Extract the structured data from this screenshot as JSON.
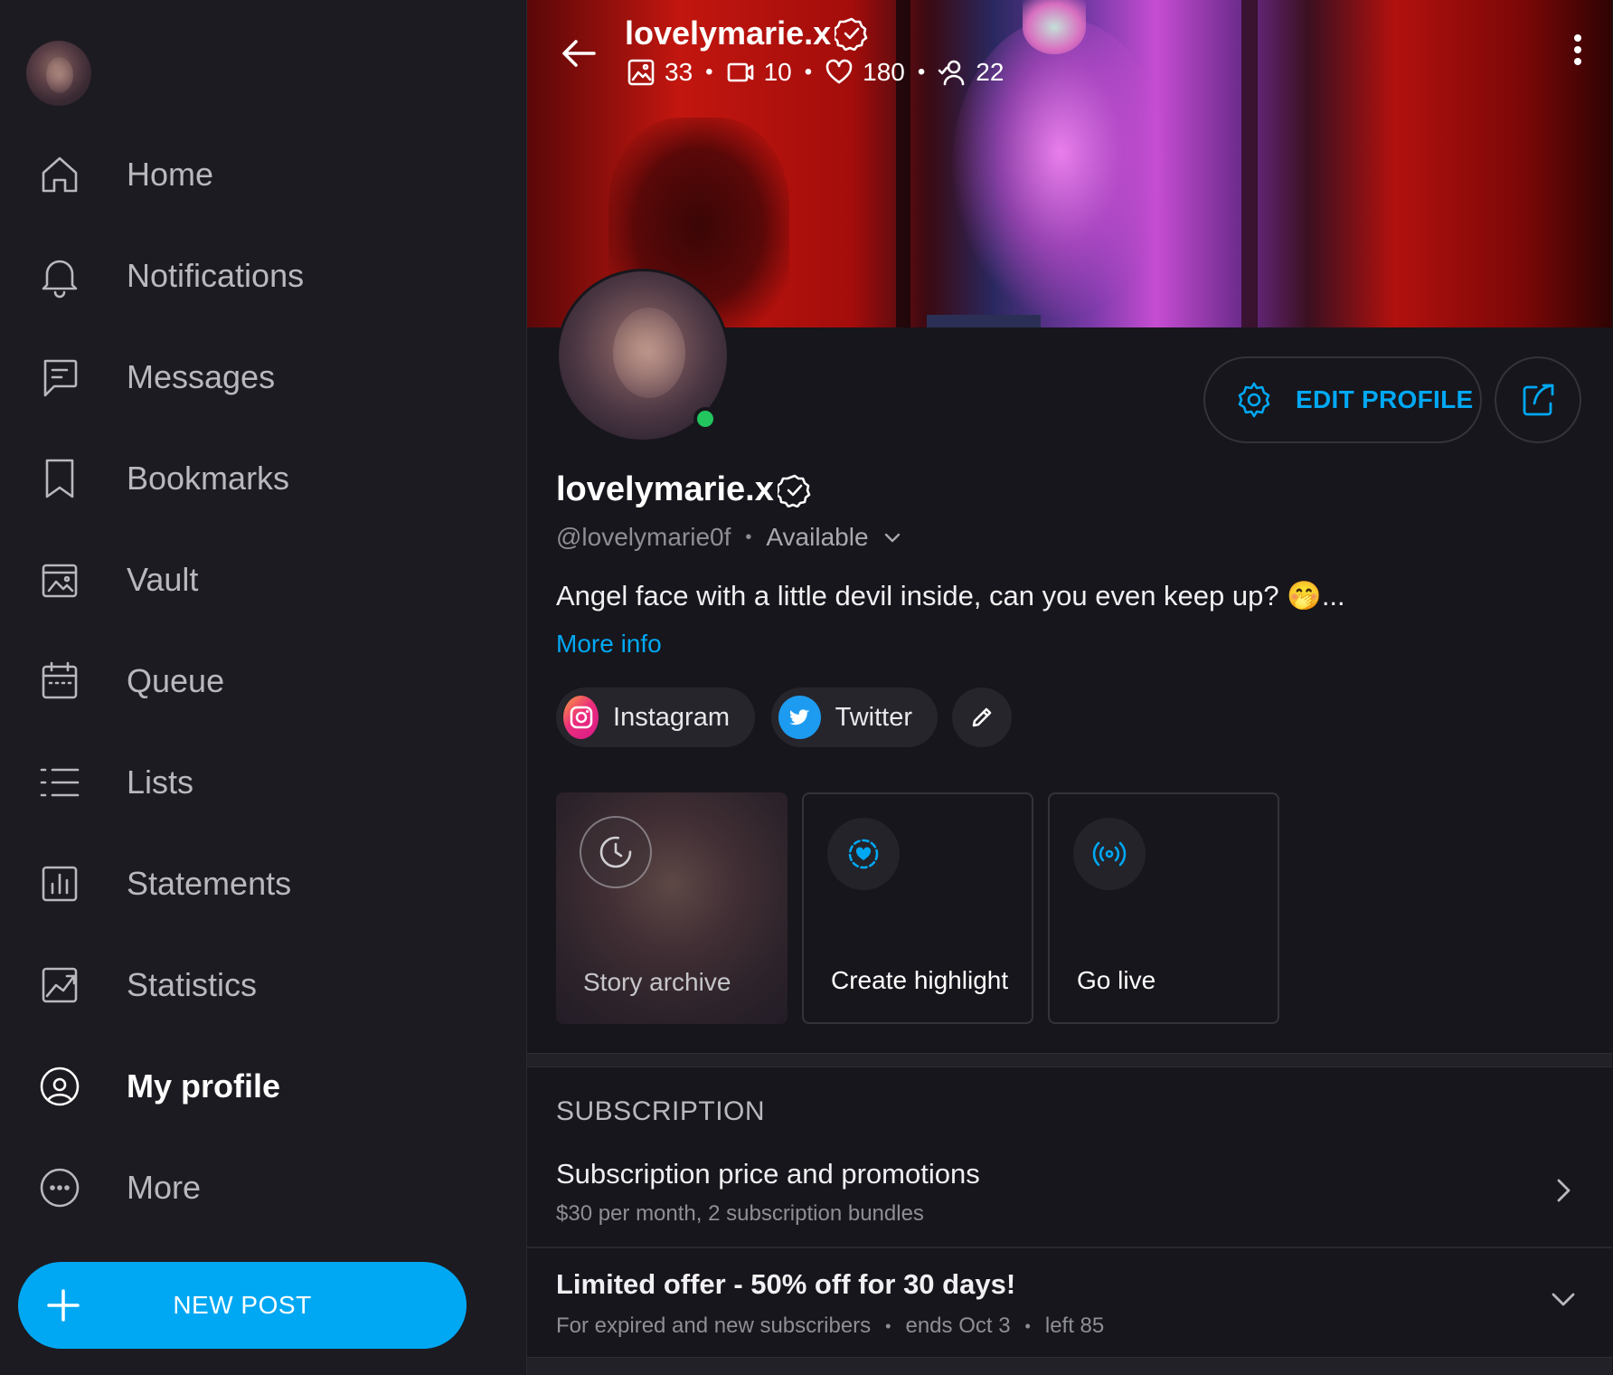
{
  "sidebar": {
    "nav": [
      {
        "label": "Home",
        "icon": "home-icon",
        "active": false
      },
      {
        "label": "Notifications",
        "icon": "bell-icon",
        "active": false
      },
      {
        "label": "Messages",
        "icon": "message-icon",
        "active": false
      },
      {
        "label": "Bookmarks",
        "icon": "bookmark-icon",
        "active": false
      },
      {
        "label": "Vault",
        "icon": "vault-icon",
        "active": false
      },
      {
        "label": "Queue",
        "icon": "calendar-icon",
        "active": false
      },
      {
        "label": "Lists",
        "icon": "list-icon",
        "active": false
      },
      {
        "label": "Statements",
        "icon": "statements-icon",
        "active": false
      },
      {
        "label": "Statistics",
        "icon": "statistics-icon",
        "active": false
      },
      {
        "label": "My profile",
        "icon": "profile-icon",
        "active": true
      },
      {
        "label": "More",
        "icon": "more-icon",
        "active": false
      }
    ],
    "new_post_label": "NEW POST"
  },
  "header": {
    "name": "lovelymarie.x",
    "stats": {
      "photos": "33",
      "videos": "10",
      "likes": "180",
      "fans": "22"
    }
  },
  "profile": {
    "name": "lovelymarie.x",
    "handle": "@lovelymarie0f",
    "status": "Available",
    "bio": "Angel face with a little devil inside, can you even keep up? 🤭...",
    "more_info_label": "More info",
    "edit_profile_label": "EDIT PROFILE",
    "socials": [
      {
        "label": "Instagram",
        "icon": "instagram-icon"
      },
      {
        "label": "Twitter",
        "icon": "twitter-icon"
      }
    ]
  },
  "cards": {
    "story_archive": "Story archive",
    "create_highlight": "Create highlight",
    "go_live": "Go live"
  },
  "subscription": {
    "title": "SUBSCRIPTION",
    "price_row": {
      "title": "Subscription price and promotions",
      "subtitle": "$30 per month, 2 subscription bundles"
    },
    "offer_row": {
      "title": "Limited offer - 50% off for 30 days!",
      "audience": "For expired and new subscribers",
      "ends": "ends Oct 3",
      "left": "left 85"
    }
  },
  "colors": {
    "accent": "#00a8f3",
    "background": "#17161c",
    "sidebar": "#1c1b21",
    "online": "#22c55e"
  }
}
